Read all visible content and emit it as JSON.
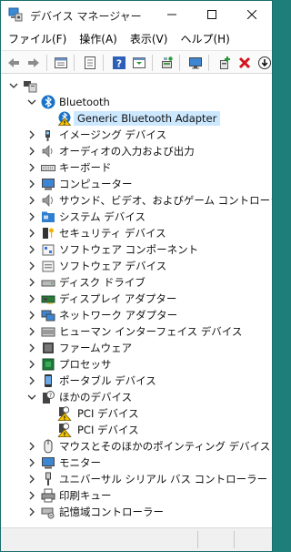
{
  "window": {
    "title": "デバイス マネージャー"
  },
  "menubar": {
    "items": [
      {
        "label": "ファイル(F)",
        "name": "menu-file"
      },
      {
        "label": "操作(A)",
        "name": "menu-action"
      },
      {
        "label": "表示(V)",
        "name": "menu-view"
      },
      {
        "label": "ヘルプ(H)",
        "name": "menu-help"
      }
    ]
  },
  "toolbar": {
    "buttons": [
      "back-arrow-icon",
      "forward-arrow-icon",
      "properties-icon",
      "update-driver-icon",
      "help-icon",
      "show-hide-console-tree-icon",
      "scan-hardware-icon",
      "monitor-icon",
      "add-legacy-icon",
      "uninstall-x-icon",
      "disable-down-icon"
    ]
  },
  "tree": {
    "root": {
      "label": "",
      "icon": "computer-icon"
    },
    "items": [
      {
        "label": "Bluetooth",
        "icon": "bluetooth-icon",
        "expanded": true,
        "level": 1
      },
      {
        "label": "Generic Bluetooth Adapter",
        "icon": "bluetooth-warning-icon",
        "level": 2,
        "selected": true
      },
      {
        "label": "イメージング デバイス",
        "icon": "camera-icon",
        "level": 1
      },
      {
        "label": "オーディオの入力および出力",
        "icon": "speaker-icon",
        "level": 1
      },
      {
        "label": "キーボード",
        "icon": "keyboard-icon",
        "level": 1
      },
      {
        "label": "コンピューター",
        "icon": "monitor-icon",
        "level": 1
      },
      {
        "label": "サウンド、ビデオ、およびゲーム コントローラー",
        "icon": "sound-icon",
        "level": 1
      },
      {
        "label": "システム デバイス",
        "icon": "system-folder-icon",
        "level": 1
      },
      {
        "label": "セキュリティ デバイス",
        "icon": "security-key-icon",
        "level": 1
      },
      {
        "label": "ソフトウェア コンポーネント",
        "icon": "software-component-icon",
        "level": 1
      },
      {
        "label": "ソフトウェア デバイス",
        "icon": "software-device-icon",
        "level": 1
      },
      {
        "label": "ディスク ドライブ",
        "icon": "disk-drive-icon",
        "level": 1
      },
      {
        "label": "ディスプレイ アダプター",
        "icon": "display-adapter-icon",
        "level": 1
      },
      {
        "label": "ネットワーク アダプター",
        "icon": "network-adapter-icon",
        "level": 1
      },
      {
        "label": "ヒューマン インターフェイス デバイス",
        "icon": "hid-icon",
        "level": 1
      },
      {
        "label": "ファームウェア",
        "icon": "firmware-icon",
        "level": 1
      },
      {
        "label": "プロセッサ",
        "icon": "processor-icon",
        "level": 1
      },
      {
        "label": "ポータブル デバイス",
        "icon": "portable-device-icon",
        "level": 1
      },
      {
        "label": "ほかのデバイス",
        "icon": "unknown-device-icon",
        "expanded": true,
        "level": 1
      },
      {
        "label": "PCI デバイス",
        "icon": "unknown-warning-icon",
        "level": 2
      },
      {
        "label": "PCI デバイス",
        "icon": "unknown-warning-icon",
        "level": 2
      },
      {
        "label": "マウスとそのほかのポインティング デバイス",
        "icon": "mouse-icon",
        "level": 1
      },
      {
        "label": "モニター",
        "icon": "monitor-icon",
        "level": 1
      },
      {
        "label": "ユニバーサル シリアル バス コントローラー",
        "icon": "usb-icon",
        "level": 1
      },
      {
        "label": "印刷キュー",
        "icon": "printer-icon",
        "level": 1
      },
      {
        "label": "記憶域コントローラー",
        "icon": "storage-controller-icon",
        "level": 1
      }
    ]
  },
  "colors": {
    "selection": "#cce8ff",
    "bluetooth": "#1a73c8",
    "warning": "#f5c400",
    "uninstall": "#d4141c"
  }
}
